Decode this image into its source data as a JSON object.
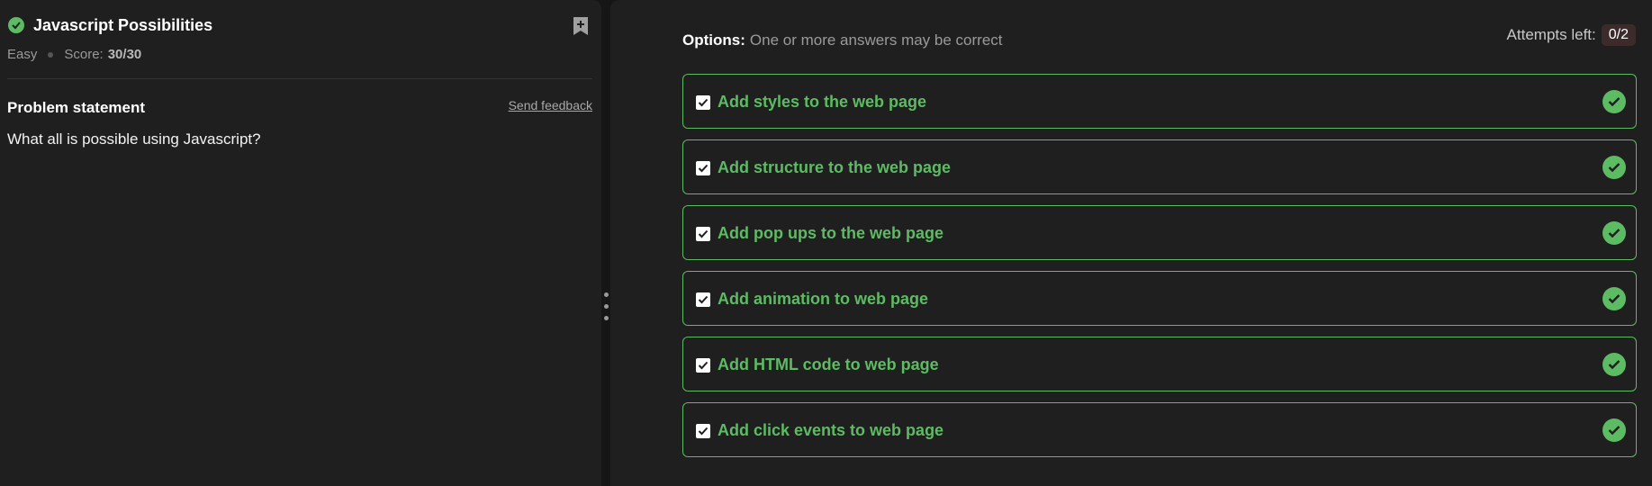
{
  "problem": {
    "title": "Javascript Possibilities",
    "difficulty": "Easy",
    "score_label": "Score:",
    "score_value": "30/30",
    "statement_heading": "Problem statement",
    "send_feedback": "Send feedback",
    "question": "What all is possible using Javascript?"
  },
  "options_panel": {
    "heading_bold": "Options:",
    "heading_hint": "One or more answers may be correct",
    "attempts_label": "Attempts left:",
    "attempts_value": "0/2",
    "options": [
      {
        "label": "Add styles to the web page"
      },
      {
        "label": "Add structure to the web page"
      },
      {
        "label": "Add pop ups to the web page"
      },
      {
        "label": "Add animation to web page"
      },
      {
        "label": "Add HTML code to web page"
      },
      {
        "label": "Add click events to web page"
      }
    ]
  },
  "colors": {
    "accent_green": "#5dbb63",
    "panel_bg": "#1f1f1f",
    "page_bg": "#161616"
  },
  "icons": {
    "status": "check-circle-icon",
    "bookmark": "bookmark-add-icon",
    "checkbox": "checkbox-checked-icon",
    "correct": "check-circle-icon",
    "handle": "drag-handle-icon"
  }
}
